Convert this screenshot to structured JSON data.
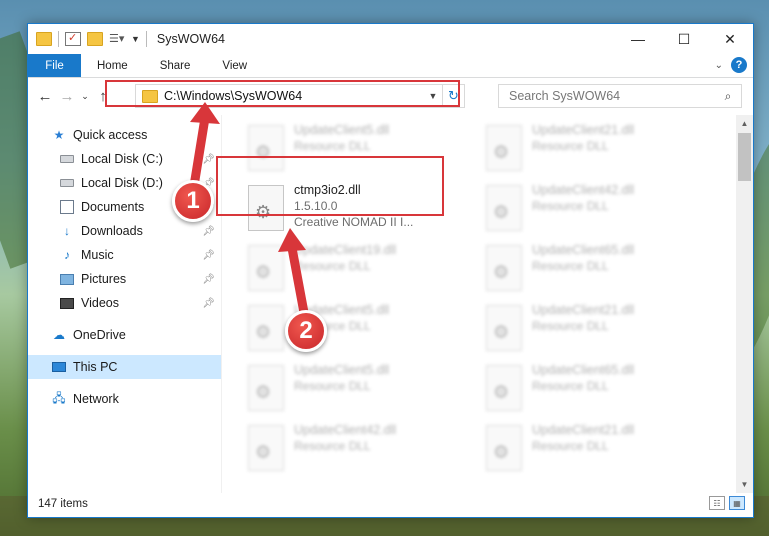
{
  "window": {
    "title": "SysWOW64"
  },
  "ribbon": {
    "tabs": [
      "File",
      "Home",
      "Share",
      "View"
    ],
    "help_label": "?"
  },
  "nav": {
    "address": "C:\\Windows\\SysWOW64",
    "search_placeholder": "Search SysWOW64"
  },
  "sidebar": {
    "items": [
      {
        "label": "Quick access",
        "icon": "star-icon",
        "pinned": false
      },
      {
        "label": "Local Disk (C:)",
        "icon": "disk-icon",
        "pinned": true
      },
      {
        "label": "Local Disk (D:)",
        "icon": "disk-icon",
        "pinned": true
      },
      {
        "label": "Documents",
        "icon": "documents-icon",
        "pinned": true
      },
      {
        "label": "Downloads",
        "icon": "download-icon",
        "pinned": true
      },
      {
        "label": "Music",
        "icon": "music-icon",
        "pinned": true
      },
      {
        "label": "Pictures",
        "icon": "pictures-icon",
        "pinned": true
      },
      {
        "label": "Videos",
        "icon": "videos-icon",
        "pinned": true
      },
      {
        "label": "OneDrive",
        "icon": "cloud-icon",
        "pinned": false
      },
      {
        "label": "This PC",
        "icon": "pc-icon",
        "pinned": false,
        "selected": true
      },
      {
        "label": "Network",
        "icon": "network-icon",
        "pinned": false
      }
    ]
  },
  "files": {
    "highlighted": {
      "name": "ctmp3io2.dll",
      "version": "1.5.10.0",
      "description": "Creative NOMAD II I..."
    },
    "left_column": [
      {
        "name": "UpdateClient5.dll",
        "type": "Resource DLL"
      },
      {
        "name": "UpdateClient19.dll",
        "type": "Resource DLL"
      },
      {
        "name": "UpdateClient5.dll",
        "type": "Resource DLL"
      },
      {
        "name": "UpdateClient5.dll",
        "type": "Resource DLL"
      },
      {
        "name": "UpdateClient42.dll",
        "type": "Resource DLL"
      }
    ],
    "right_column": [
      {
        "name": "UpdateClient21.dll",
        "type": "Resource DLL"
      },
      {
        "name": "UpdateClient42.dll",
        "type": "Resource DLL"
      },
      {
        "name": "UpdateClient65.dll",
        "type": "Resource DLL"
      },
      {
        "name": "UpdateClient21.dll",
        "type": "Resource DLL"
      },
      {
        "name": "UpdateClient65.dll",
        "type": "Resource DLL"
      },
      {
        "name": "UpdateClient21.dll",
        "type": "Resource DLL"
      }
    ]
  },
  "status": {
    "item_count": "147 items"
  },
  "annotations": {
    "step1": "1",
    "step2": "2"
  },
  "colors": {
    "accent": "#1979ca",
    "highlight": "#d8363a",
    "selection": "#cce8ff"
  }
}
